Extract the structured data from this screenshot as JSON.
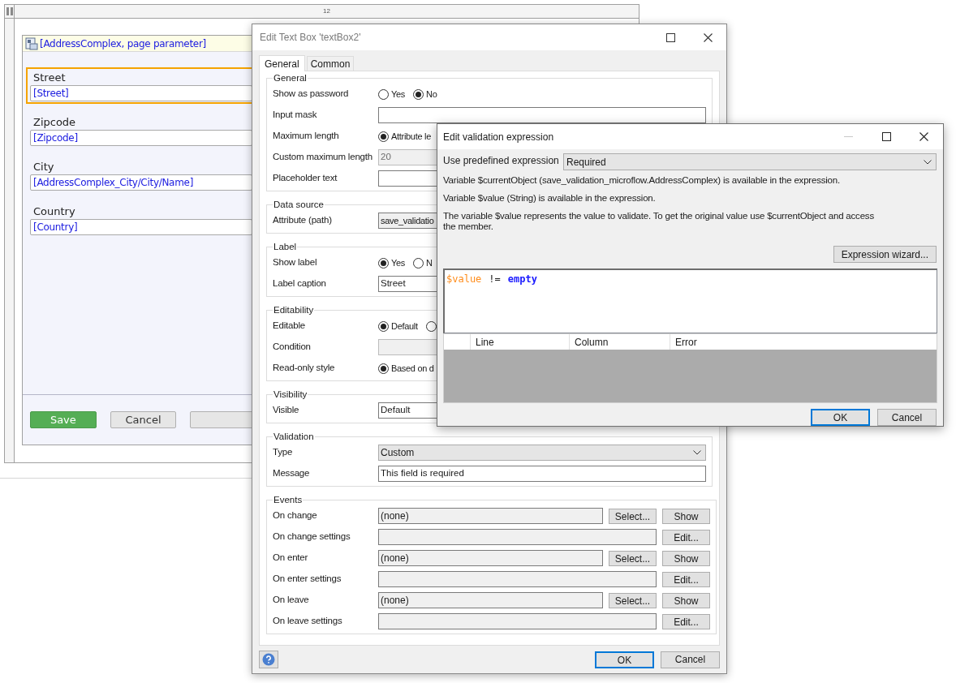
{
  "page_editor": {
    "ruler_label": "12",
    "data_view": {
      "title": "[AddressComplex, page parameter]"
    },
    "fields": [
      {
        "label": "Street",
        "value": "[Street]",
        "selected": true
      },
      {
        "label": "Zipcode",
        "value": "[Zipcode]",
        "selected": false
      },
      {
        "label": "City",
        "value": "[AddressComplex_City/City/Name]",
        "selected": false
      },
      {
        "label": "Country",
        "value": "[Country]",
        "selected": false
      }
    ],
    "buttons": [
      {
        "kind": "primary",
        "label": "Save"
      },
      {
        "kind": "default",
        "label": "Cancel"
      },
      {
        "kind": "default"
      }
    ]
  },
  "text_box_dialog": {
    "title": "Edit Text Box 'textBox2'",
    "tabs": [
      {
        "label": "General",
        "selected": true
      },
      {
        "label": "Common",
        "selected": false
      }
    ],
    "groups": [
      {
        "legend": "General",
        "rows": [
          {
            "kind": "radio",
            "label": "Show as password",
            "options": [
              {
                "label": "Yes",
                "selected": false
              },
              {
                "label": "No",
                "selected": true
              }
            ]
          },
          {
            "kind": "text",
            "label": "Input mask",
            "disabled": false
          },
          {
            "kind": "radio",
            "label": "Maximum length",
            "options": [
              {
                "label": "Attribute le",
                "selected": true
              }
            ]
          },
          {
            "kind": "text",
            "label": "Custom maximum length",
            "value": "20",
            "disabled": true
          },
          {
            "kind": "text",
            "label": "Placeholder text",
            "disabled": false
          }
        ]
      },
      {
        "legend": "Data source",
        "rows": [
          {
            "kind": "readonly",
            "label": "Attribute (path)",
            "value": "save_validatio"
          }
        ]
      },
      {
        "legend": "Label",
        "rows": [
          {
            "kind": "radio",
            "label": "Show label",
            "options": [
              {
                "label": "Yes",
                "selected": true
              },
              {
                "label": "N",
                "selected": false
              }
            ]
          },
          {
            "kind": "text",
            "label": "Label caption",
            "value": "Street",
            "disabled": false
          }
        ]
      },
      {
        "legend": "Editability",
        "rows": [
          {
            "kind": "radio",
            "label": "Editable",
            "options": [
              {
                "label": "Default",
                "selected": true
              },
              {
                "selected": false
              }
            ]
          },
          {
            "kind": "text",
            "label": "Condition",
            "disabled": true
          },
          {
            "kind": "radio",
            "label": "Read-only style",
            "options": [
              {
                "label": "Based on d",
                "selected": true
              }
            ]
          }
        ]
      },
      {
        "legend": "Visibility",
        "rows": [
          {
            "kind": "text",
            "label": "Visible",
            "value": "Default",
            "disabled": false
          }
        ]
      },
      {
        "legend": "Validation",
        "rows": [
          {
            "kind": "dropdown",
            "label": "Type",
            "value": "Custom"
          },
          {
            "kind": "text",
            "label": "Message",
            "value": "This field is required",
            "disabled": false
          }
        ]
      },
      {
        "legend": "Events",
        "rows": [
          {
            "kind": "chooser",
            "label": "On change",
            "value": "(none)",
            "buttons": [
              "Select...",
              "Show"
            ]
          },
          {
            "kind": "settings",
            "label": "On change settings",
            "buttons": [
              "Edit..."
            ]
          },
          {
            "kind": "chooser",
            "label": "On enter",
            "value": "(none)",
            "buttons": [
              "Select...",
              "Show"
            ]
          },
          {
            "kind": "settings",
            "label": "On enter settings",
            "buttons": [
              "Edit..."
            ]
          },
          {
            "kind": "chooser",
            "label": "On leave",
            "value": "(none)",
            "buttons": [
              "Select...",
              "Show"
            ]
          },
          {
            "kind": "settings",
            "label": "On leave settings",
            "buttons": [
              "Edit..."
            ]
          }
        ]
      }
    ],
    "footer_buttons": [
      {
        "label": "OK",
        "default": true
      },
      {
        "label": "Cancel",
        "default": false
      }
    ]
  },
  "validation_dialog": {
    "title": "Edit validation expression",
    "predefined": {
      "label": "Use predefined expression",
      "value": "Required"
    },
    "notes": [
      "Variable $currentObject (save_validation_microflow.AddressComplex) is available in the expression.",
      "Variable $value (String) is available in the expression.",
      "The variable $value represents the value to validate. To get the original value use $currentObject and access the member."
    ],
    "wizard_button": "Expression wizard...",
    "expression": [
      {
        "kind": "variable",
        "text": "$value"
      },
      {
        "kind": "operator",
        "text": "!="
      },
      {
        "kind": "keyword",
        "text": "empty"
      }
    ],
    "error_table": {
      "columns": [
        "Line",
        "Column",
        "Error"
      ]
    },
    "buttons": [
      {
        "label": "OK",
        "default": true
      },
      {
        "label": "Cancel",
        "default": false
      }
    ]
  }
}
